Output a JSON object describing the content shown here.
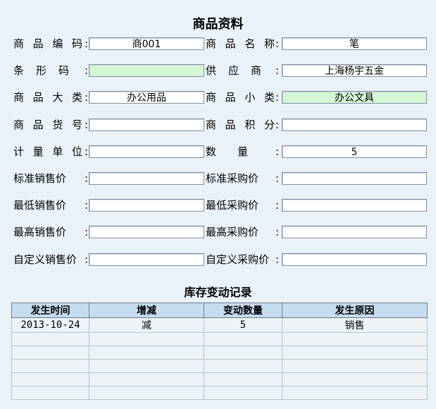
{
  "title": "商品资料",
  "form": {
    "rows": [
      {
        "l1": "商品编码",
        "v1": "商001",
        "g1": false,
        "l2": "商品名称",
        "v2": "笔",
        "g2": false
      },
      {
        "l1": "条形码",
        "v1": "",
        "g1": true,
        "l2": "供应商",
        "v2": "上海杨宇五金",
        "g2": false
      },
      {
        "l1": "商品大类",
        "v1": "办公用品",
        "g1": false,
        "l2": "商品小类",
        "v2": "办公文具",
        "g2": true
      },
      {
        "l1": "商品货号",
        "v1": "",
        "g1": false,
        "l2": "商品积分",
        "v2": "",
        "g2": false
      },
      {
        "l1": "计量单位",
        "v1": "",
        "g1": false,
        "l2": "数量",
        "v2": "5",
        "g2": false
      },
      {
        "l1": "标准销售价",
        "v1": "",
        "g1": false,
        "l2": "标准采购价",
        "v2": "",
        "g2": false
      },
      {
        "l1": "最低销售价",
        "v1": "",
        "g1": false,
        "l2": "最低采购价",
        "v2": "",
        "g2": false
      },
      {
        "l1": "最高销售价",
        "v1": "",
        "g1": false,
        "l2": "最高采购价",
        "v2": "",
        "g2": false
      },
      {
        "l1": "自定义销售价",
        "v1": "",
        "g1": false,
        "l2": "自定义采购价",
        "v2": "",
        "g2": false
      }
    ],
    "colon": ":"
  },
  "inventory": {
    "title": "库存变动记录",
    "headers": [
      "发生时间",
      "增减",
      "变动数量",
      "发生原因"
    ],
    "rows": [
      [
        "2013-10-24",
        "减",
        "5",
        "销售"
      ],
      [
        "",
        "",
        "",
        ""
      ],
      [
        "",
        "",
        "",
        ""
      ],
      [
        "",
        "",
        "",
        ""
      ],
      [
        "",
        "",
        "",
        ""
      ],
      [
        "",
        "",
        "",
        ""
      ]
    ]
  },
  "colors": {
    "background": "#eaf2f9",
    "highlight_field": "#d5f7d5",
    "table_header": "#c6dcf1"
  }
}
